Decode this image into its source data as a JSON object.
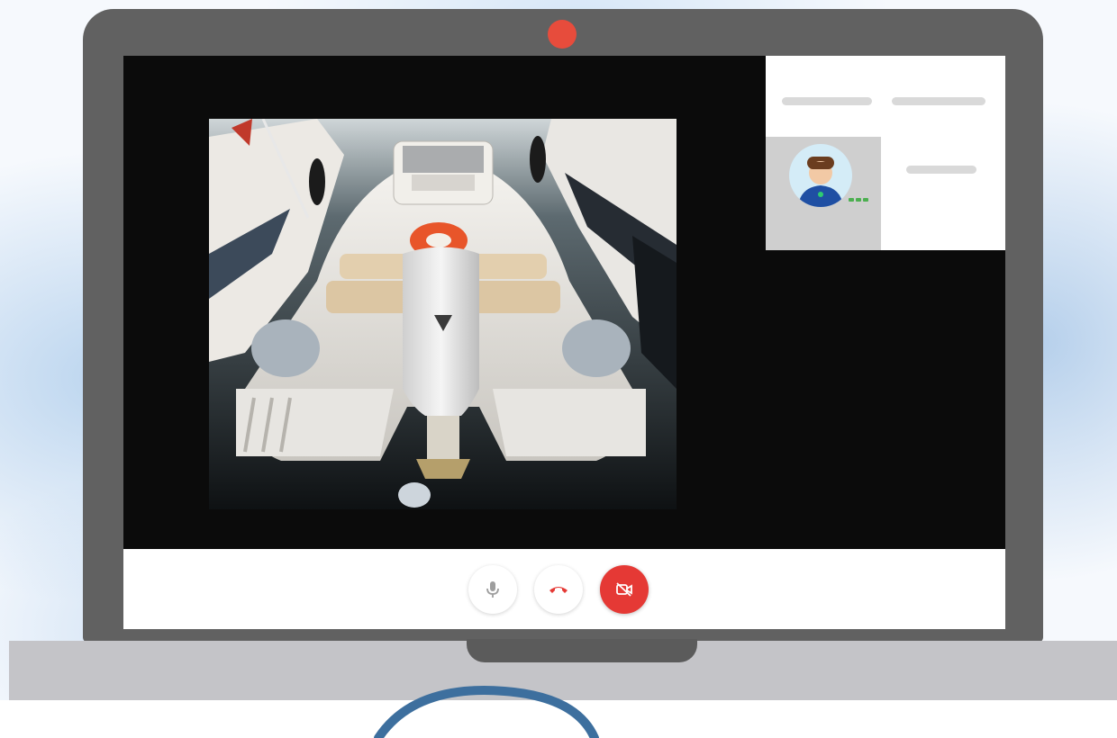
{
  "colors": {
    "laptop_frame": "#616161",
    "camera_dot": "#e74c3c",
    "screen_bg": "#0b0b0b",
    "end_call_icon": "#e53935",
    "video_off_button": "#e53935",
    "online_status": "#4caf50"
  },
  "main_video": {
    "subject": "boat-stern-outboard-motor"
  },
  "participants_panel": {
    "avatar": "user-avatar-icon",
    "status": "online"
  },
  "controls": [
    {
      "name": "mic-button",
      "icon": "microphone-icon"
    },
    {
      "name": "end-call-button",
      "icon": "phone-hangup-icon"
    },
    {
      "name": "video-off-button",
      "icon": "video-off-icon"
    }
  ]
}
